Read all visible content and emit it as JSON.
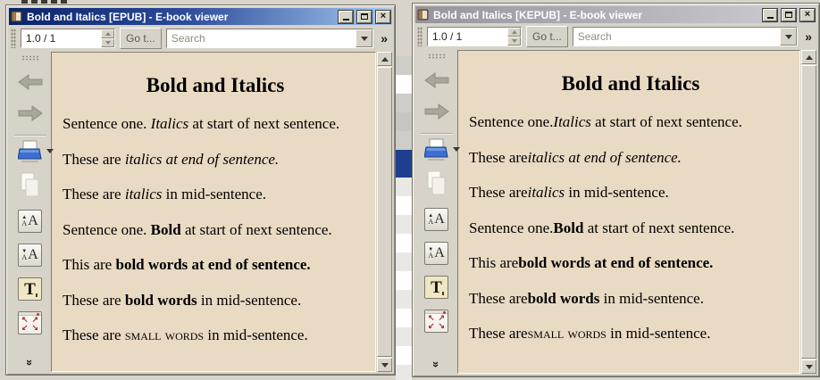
{
  "background": {
    "list_selected_color": "#1d3f8e"
  },
  "icons": {
    "overflow_glyph": "»",
    "collapse_glyph": "»",
    "close_glyph": "×",
    "font_up_marker": "▲",
    "font_down_marker": "▼",
    "font_letter_small": "A",
    "font_letter_big": "A",
    "text_settings_letter": "T",
    "fullscreen_arrows": [
      "↖",
      "↗",
      "↙",
      "↘"
    ]
  },
  "left_window": {
    "title": "Bold and Italics [EPUB] - E-book viewer",
    "toolbar": {
      "page_indicator": "1.0 / 1",
      "goto_button": "Go t...",
      "search_placeholder": "Search"
    },
    "content": {
      "heading": "Bold and Italics",
      "paragraphs": [
        {
          "pre": "Sentence one. ",
          "styled": "Italics",
          "post": " at start of next sentence."
        },
        {
          "pre": "These are ",
          "styled": "italics at end of sentence.",
          "post": ""
        },
        {
          "pre": "These are ",
          "styled": "italics",
          "post": " in mid-sentence."
        },
        {
          "pre": "Sentence one. ",
          "styled": "Bold",
          "post": " at start of next sentence."
        },
        {
          "pre": "This are ",
          "styled": "bold words at end of sentence.",
          "post": ""
        },
        {
          "pre": "These are ",
          "styled": "bold words",
          "post": " in mid-sentence."
        },
        {
          "pre": "These are ",
          "styled": "small words",
          "post": " in mid-sentence."
        }
      ]
    }
  },
  "right_window": {
    "title": "Bold and Italics [KEPUB] - E-book viewer",
    "toolbar": {
      "page_indicator": "1.0 / 1",
      "goto_button": "Go t...",
      "search_placeholder": "Search"
    },
    "content": {
      "heading": "Bold and Italics",
      "paragraphs": [
        {
          "pre": "Sentence one.",
          "styled": "Italics",
          "post": " at start of next sentence."
        },
        {
          "pre": "These are",
          "styled": "italics at end of sentence.",
          "post": ""
        },
        {
          "pre": "These are",
          "styled": "italics",
          "post": " in mid-sentence."
        },
        {
          "pre": "Sentence one.",
          "styled": "Bold",
          "post": " at start of next sentence."
        },
        {
          "pre": "This are",
          "styled": "bold words at end of sentence.",
          "post": ""
        },
        {
          "pre": "These are",
          "styled": "bold words",
          "post": " in mid-sentence."
        },
        {
          "pre": "These are",
          "styled": "small words",
          "post": " in mid-sentence."
        }
      ]
    }
  }
}
